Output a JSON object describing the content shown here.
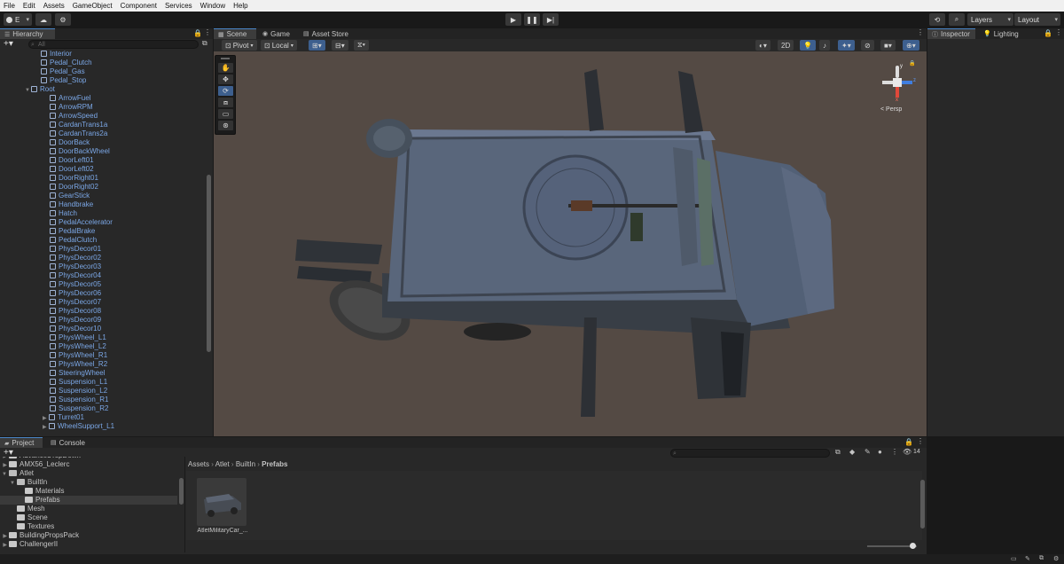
{
  "menu": [
    "File",
    "Edit",
    "Assets",
    "GameObject",
    "Component",
    "Services",
    "Window",
    "Help"
  ],
  "toolbar": {
    "account_label": "E",
    "layers_label": "Layers",
    "layout_label": "Layout"
  },
  "hierarchy": {
    "tab": "Hierarchy",
    "search_placeholder": "All",
    "items": [
      {
        "label": "Interior",
        "indent": 1,
        "arrow": ""
      },
      {
        "label": "Pedal_Clutch",
        "indent": 1,
        "arrow": ""
      },
      {
        "label": "Pedal_Gas",
        "indent": 1,
        "arrow": ""
      },
      {
        "label": "Pedal_Stop",
        "indent": 1,
        "arrow": ""
      },
      {
        "label": "Root",
        "indent": 0,
        "arrow": "▼"
      },
      {
        "label": "ArrowFuel",
        "indent": 2,
        "arrow": ""
      },
      {
        "label": "ArrowRPM",
        "indent": 2,
        "arrow": ""
      },
      {
        "label": "ArrowSpeed",
        "indent": 2,
        "arrow": ""
      },
      {
        "label": "CardanTrans1a",
        "indent": 2,
        "arrow": ""
      },
      {
        "label": "CardanTrans2a",
        "indent": 2,
        "arrow": ""
      },
      {
        "label": "DoorBack",
        "indent": 2,
        "arrow": ""
      },
      {
        "label": "DoorBackWheel",
        "indent": 2,
        "arrow": ""
      },
      {
        "label": "DoorLeft01",
        "indent": 2,
        "arrow": ""
      },
      {
        "label": "DoorLeft02",
        "indent": 2,
        "arrow": ""
      },
      {
        "label": "DoorRight01",
        "indent": 2,
        "arrow": ""
      },
      {
        "label": "DoorRight02",
        "indent": 2,
        "arrow": ""
      },
      {
        "label": "GearStick",
        "indent": 2,
        "arrow": ""
      },
      {
        "label": "Handbrake",
        "indent": 2,
        "arrow": ""
      },
      {
        "label": "Hatch",
        "indent": 2,
        "arrow": ""
      },
      {
        "label": "PedalAccelerator",
        "indent": 2,
        "arrow": ""
      },
      {
        "label": "PedalBrake",
        "indent": 2,
        "arrow": ""
      },
      {
        "label": "PedalClutch",
        "indent": 2,
        "arrow": ""
      },
      {
        "label": "PhysDecor01",
        "indent": 2,
        "arrow": ""
      },
      {
        "label": "PhysDecor02",
        "indent": 2,
        "arrow": ""
      },
      {
        "label": "PhysDecor03",
        "indent": 2,
        "arrow": ""
      },
      {
        "label": "PhysDecor04",
        "indent": 2,
        "arrow": ""
      },
      {
        "label": "PhysDecor05",
        "indent": 2,
        "arrow": ""
      },
      {
        "label": "PhysDecor06",
        "indent": 2,
        "arrow": ""
      },
      {
        "label": "PhysDecor07",
        "indent": 2,
        "arrow": ""
      },
      {
        "label": "PhysDecor08",
        "indent": 2,
        "arrow": ""
      },
      {
        "label": "PhysDecor09",
        "indent": 2,
        "arrow": ""
      },
      {
        "label": "PhysDecor10",
        "indent": 2,
        "arrow": ""
      },
      {
        "label": "PhysWheel_L1",
        "indent": 2,
        "arrow": ""
      },
      {
        "label": "PhysWheel_L2",
        "indent": 2,
        "arrow": ""
      },
      {
        "label": "PhysWheel_R1",
        "indent": 2,
        "arrow": ""
      },
      {
        "label": "PhysWheel_R2",
        "indent": 2,
        "arrow": ""
      },
      {
        "label": "SteeringWheel",
        "indent": 2,
        "arrow": ""
      },
      {
        "label": "Suspension_L1",
        "indent": 2,
        "arrow": ""
      },
      {
        "label": "Suspension_L2",
        "indent": 2,
        "arrow": ""
      },
      {
        "label": "Suspension_R1",
        "indent": 2,
        "arrow": ""
      },
      {
        "label": "Suspension_R2",
        "indent": 2,
        "arrow": ""
      },
      {
        "label": "Turret01",
        "indent": 2,
        "arrow": "▶"
      },
      {
        "label": "WheelSupport_L1",
        "indent": 2,
        "arrow": "▶"
      }
    ]
  },
  "scene": {
    "tabs": [
      "Scene",
      "Game",
      "Asset Store"
    ],
    "pivot_label": "Pivot",
    "local_label": "Local",
    "mode_2d": "2D",
    "gizmo_persp": "< Persp",
    "axis_y": "y",
    "axis_z": "z",
    "axis_x": "x"
  },
  "inspector": {
    "tabs": [
      "Inspector",
      "Lighting"
    ]
  },
  "project": {
    "tabs": [
      "Project",
      "Console"
    ],
    "tree": [
      {
        "label": "AdvancedTopDown",
        "indent": 1,
        "arrow": "▶",
        "cut": true
      },
      {
        "label": "AMX56_Leclerc",
        "indent": 1,
        "arrow": "▶"
      },
      {
        "label": "Atlet",
        "indent": 1,
        "arrow": "▼",
        "open": true
      },
      {
        "label": "BuiltIn",
        "indent": 2,
        "arrow": "▼",
        "open": true
      },
      {
        "label": "Materials",
        "indent": 3,
        "arrow": ""
      },
      {
        "label": "Prefabs",
        "indent": 3,
        "arrow": "",
        "selected": true
      },
      {
        "label": "Mesh",
        "indent": 2,
        "arrow": ""
      },
      {
        "label": "Scene",
        "indent": 2,
        "arrow": ""
      },
      {
        "label": "Textures",
        "indent": 2,
        "arrow": ""
      },
      {
        "label": "BuildingPropsPack",
        "indent": 1,
        "arrow": "▶"
      },
      {
        "label": "ChallengerII",
        "indent": 1,
        "arrow": "▶"
      }
    ],
    "breadcrumb": [
      "Assets",
      "Atlet",
      "BuiltIn",
      "Prefabs"
    ],
    "asset_count": "14",
    "asset_name": "AtletMilitaryCar_..."
  }
}
